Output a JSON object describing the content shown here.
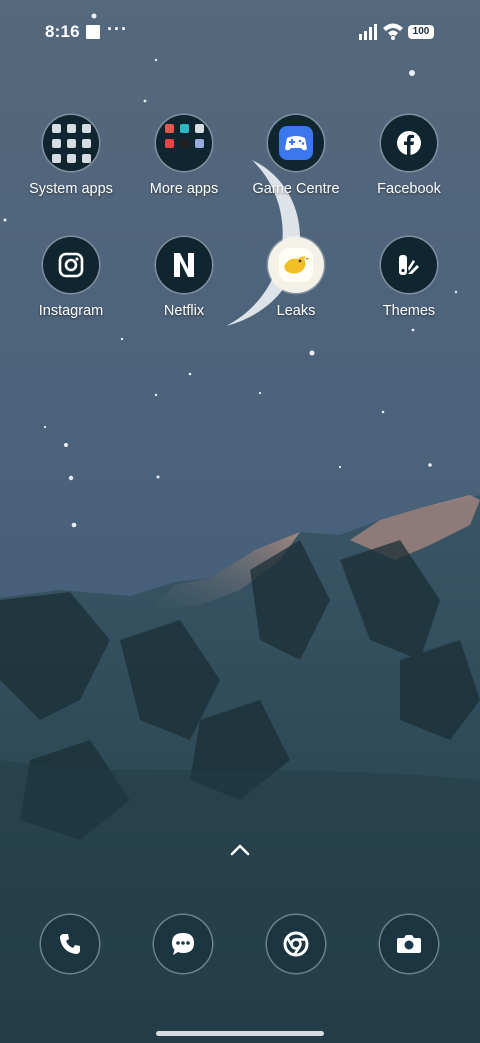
{
  "status": {
    "time": "8:16",
    "more_indicator": "···",
    "battery": "100"
  },
  "apps": [
    {
      "label": "System apps",
      "icon": "folder-icon"
    },
    {
      "label": "More apps",
      "icon": "folder-icon"
    },
    {
      "label": "Game Centre",
      "icon": "game-controller-icon"
    },
    {
      "label": "Facebook",
      "icon": "facebook-icon"
    },
    {
      "label": "Instagram",
      "icon": "instagram-icon"
    },
    {
      "label": "Netflix",
      "icon": "netflix-icon"
    },
    {
      "label": "Leaks",
      "icon": "bird-icon"
    },
    {
      "label": "Themes",
      "icon": "themes-icon"
    }
  ],
  "dock": [
    {
      "icon": "phone-icon"
    },
    {
      "icon": "messages-icon"
    },
    {
      "icon": "chrome-icon"
    },
    {
      "icon": "camera-icon"
    }
  ],
  "colors": {
    "sky": "#4a5f74",
    "icon_bg": "#0f2630",
    "game_accent": "#3b78ef",
    "leaks_accent": "#f2c024"
  }
}
